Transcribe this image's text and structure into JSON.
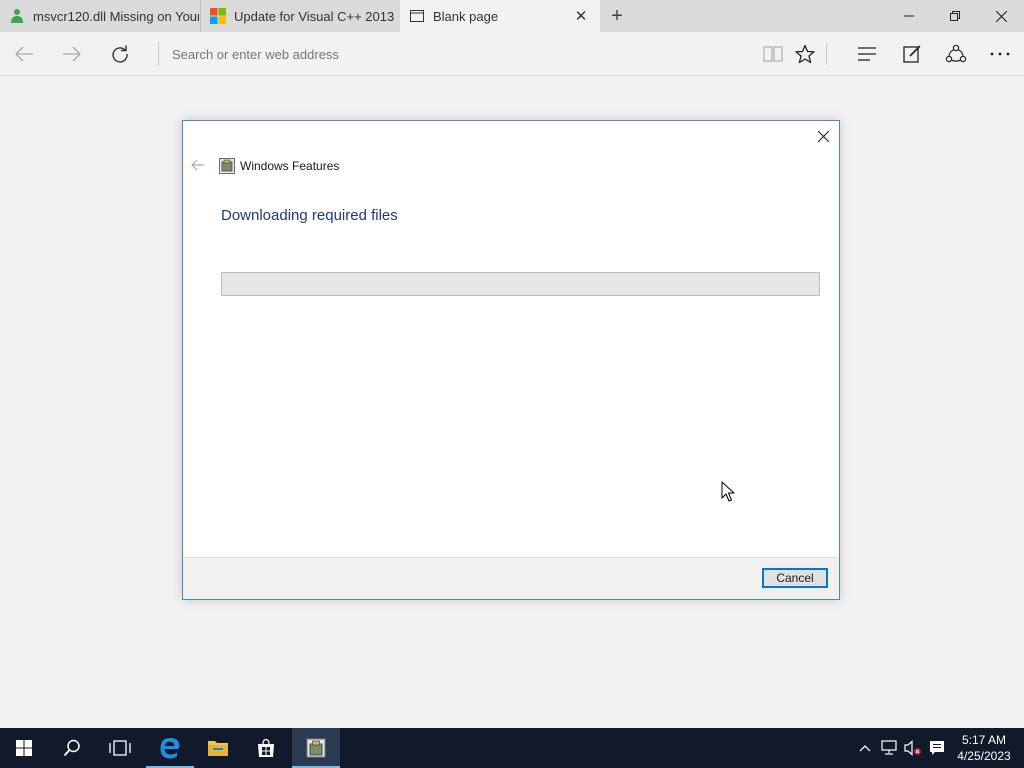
{
  "browser": {
    "tabs": [
      {
        "title": "msvcr120.dll Missing on Your",
        "favicon": "green-person-icon"
      },
      {
        "title": "Update for Visual C++ 2013",
        "favicon": "microsoft-logo-icon"
      },
      {
        "title": "Blank page",
        "favicon": "blank-page-icon",
        "active": true
      }
    ],
    "address_placeholder": "Search or enter web address"
  },
  "dialog": {
    "app_title": "Windows Features",
    "heading": "Downloading required files",
    "progress_percent": 0,
    "cancel_label": "Cancel"
  },
  "taskbar": {
    "time": "5:17 AM",
    "date": "4/25/2023"
  },
  "colors": {
    "dialog_border": "#4c86c4",
    "heading": "#1e3a78",
    "taskbar": "#101a2b",
    "accent": "#0078d7"
  }
}
